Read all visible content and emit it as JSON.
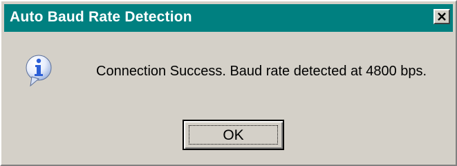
{
  "window": {
    "title": "Auto Baud Rate Detection",
    "close_icon": "close-x-icon"
  },
  "content": {
    "icon": "information-icon",
    "message": "Connection Success. Baud rate detected at 4800 bps."
  },
  "buttons": {
    "ok_label": "OK"
  },
  "colors": {
    "titlebar": "#008080",
    "dialog_face": "#d4d0c8",
    "info_icon_blue": "#2c5fd6"
  }
}
